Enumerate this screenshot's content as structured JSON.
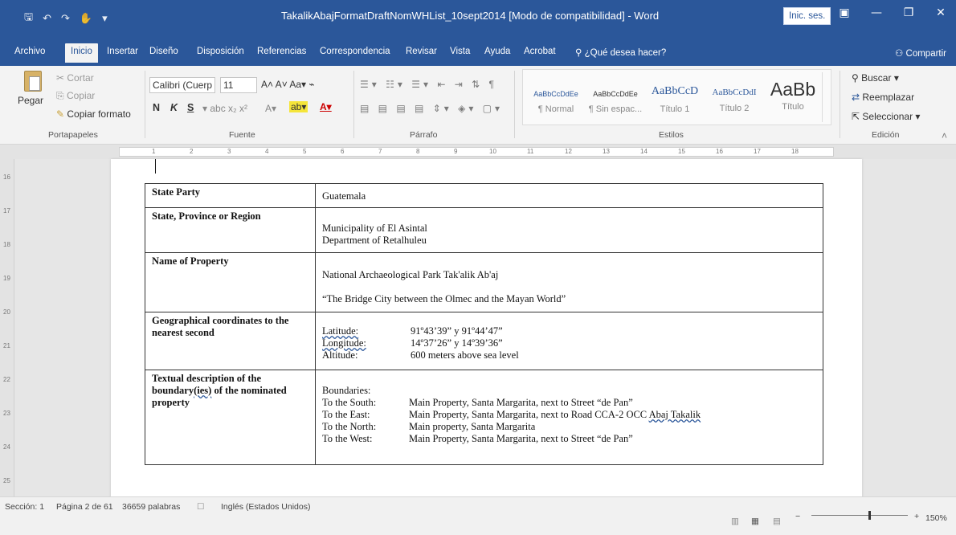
{
  "window": {
    "title": "TakalikAbajFormatDraftNomWHList_10sept2014 [Modo de compatibilidad] - Word",
    "sign_in": "Inic. ses.",
    "accent": "#2b579a"
  },
  "tabs": {
    "items": [
      "Archivo",
      "Inicio",
      "Insertar",
      "Diseño",
      "Disposición",
      "Referencias",
      "Correspondencia",
      "Revisar",
      "Vista",
      "Ayuda",
      "Acrobat"
    ],
    "tell_me": "¿Qué desea hacer?",
    "share": "Compartir"
  },
  "ribbon": {
    "clipboard": {
      "paste": "Pegar",
      "cut": "Cortar",
      "copy": "Copiar",
      "format_painter": "Copiar formato",
      "label": "Portapapeles"
    },
    "font": {
      "name": "Calibri (Cuerp",
      "size": "11",
      "bold": "N",
      "italic": "K",
      "underline": "S",
      "label": "Fuente"
    },
    "paragraph": {
      "label": "Párrafo"
    },
    "styles": {
      "label": "Estilos",
      "items": [
        {
          "preview": "AaBbCcDdEe",
          "name": "¶ Normal"
        },
        {
          "preview": "AaBbCcDdEe",
          "name": "¶ Sin espac..."
        },
        {
          "preview": "AaBbCcD",
          "name": "Título 1"
        },
        {
          "preview": "AaBbCcDdI",
          "name": "Título 2"
        },
        {
          "preview": "AaBb",
          "name": "Título"
        }
      ]
    },
    "editing": {
      "find": "Buscar",
      "replace": "Reemplazar",
      "select": "Seleccionar",
      "label": "Edición"
    }
  },
  "document": {
    "rows": {
      "state_party": {
        "label": "State Party",
        "value": "Guatemala"
      },
      "region": {
        "label": "State, Province or Region",
        "line1": "Municipality of El Asintal",
        "line2": "Department of Retalhuleu"
      },
      "property": {
        "label": "Name of Property",
        "line1": "National Archaeological Park Tak'alik Ab'aj",
        "line2": "“The Bridge City between the Olmec and the Mayan World”"
      },
      "coords": {
        "label": "Geographical coordinates to the nearest second",
        "lat_label": "Latitude:",
        "lat_value": "91º43’39” y 91º44’47”",
        "lon_label": "Longitude:",
        "lon_value": "14º37’26” y 14º39’36”",
        "alt_label": "Altitude:",
        "alt_value": "600 meters above sea level"
      },
      "boundaries": {
        "label_part1": "Textual description of the",
        "label_part2": "boundary",
        "label_part3": "(ies)",
        "label_part4": " of the nominated",
        "label_part5": "property",
        "title": "Boundaries:",
        "south_label": "To the South:",
        "south_value": "Main Property, Santa Margarita, next to Street “de Pan”",
        "east_label": "To the East:",
        "east_value_a": "Main Property, Santa Margarita, next to Road CCA-2 OCC ",
        "east_value_b": "Abaj Takalik",
        "north_label": "To the North:",
        "north_value": "Main property, Santa Margarita",
        "west_label": "To the West:",
        "west_value": "Main Property, Santa Margarita, next to Street “de Pan”"
      }
    }
  },
  "status": {
    "section": "Sección: 1",
    "page": "Página 2 de 61",
    "words": "36659 palabras",
    "language": "Inglés (Estados Unidos)",
    "zoom": "150%",
    "zoom_fraction": 0.6
  }
}
